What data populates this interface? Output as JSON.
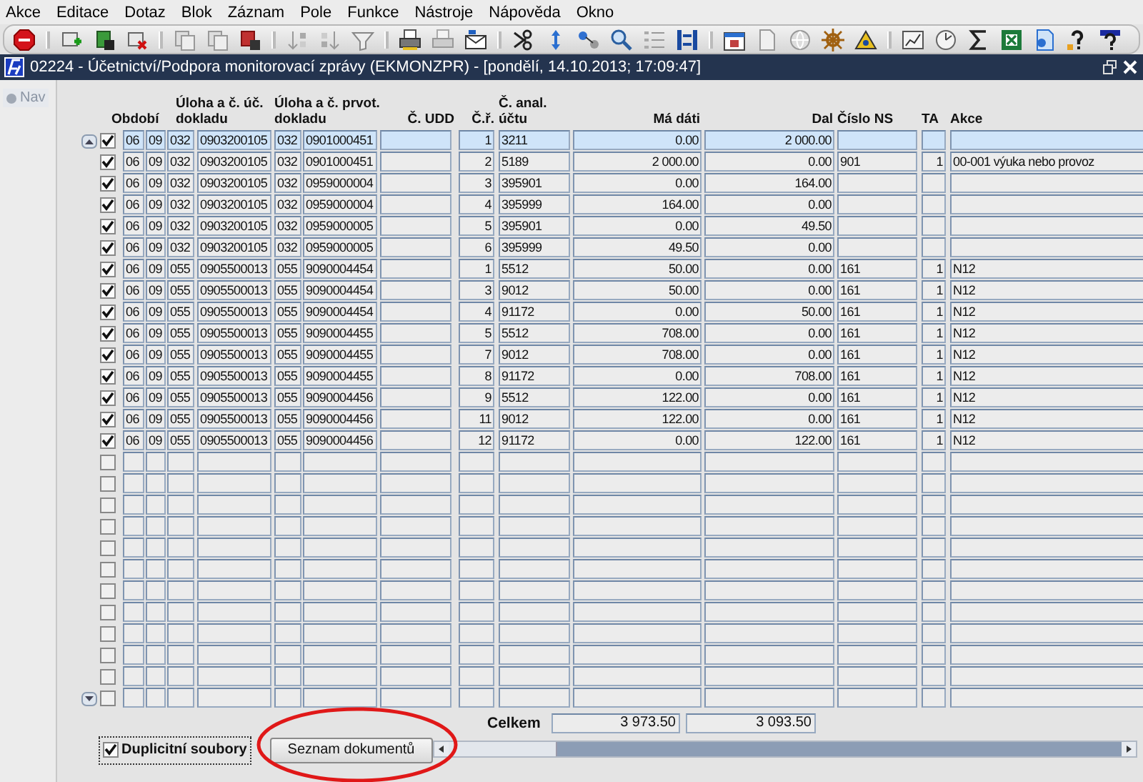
{
  "menu": [
    "Akce",
    "Editace",
    "Dotaz",
    "Blok",
    "Záznam",
    "Pole",
    "Funkce",
    "Nástroje",
    "Nápověda",
    "Okno"
  ],
  "window": {
    "title": "02224 - Účetnictví/Podpora monitorovací zprávy (EKMONZPR) - [pondělí, 14.10.2013; 17:09:47]"
  },
  "nav": {
    "label": "Nav"
  },
  "table": {
    "headers": [
      "Období",
      "Úloha a č. úč. dokladu",
      "Úloha a č. prvot. dokladu",
      "Č. UDD",
      "Č.ř.",
      "Č. anal. účtu",
      "Má dáti",
      "Dal",
      "Číslo NS",
      "TA",
      "Akce"
    ],
    "rows": [
      {
        "checked": true,
        "selected": true,
        "cells": [
          "06",
          "09",
          "032",
          "0903200105",
          "032",
          "0901000451",
          "",
          "1",
          "3211",
          "0.00",
          "2 000.00",
          "",
          "",
          ""
        ]
      },
      {
        "checked": true,
        "selected": false,
        "cells": [
          "06",
          "09",
          "032",
          "0903200105",
          "032",
          "0901000451",
          "",
          "2",
          "5189",
          "2 000.00",
          "0.00",
          "901",
          "1",
          "00-001 výuka nebo provoz"
        ]
      },
      {
        "checked": true,
        "selected": false,
        "cells": [
          "06",
          "09",
          "032",
          "0903200105",
          "032",
          "0959000004",
          "",
          "3",
          "395901",
          "0.00",
          "164.00",
          "",
          "",
          ""
        ]
      },
      {
        "checked": true,
        "selected": false,
        "cells": [
          "06",
          "09",
          "032",
          "0903200105",
          "032",
          "0959000004",
          "",
          "4",
          "395999",
          "164.00",
          "0.00",
          "",
          "",
          ""
        ]
      },
      {
        "checked": true,
        "selected": false,
        "cells": [
          "06",
          "09",
          "032",
          "0903200105",
          "032",
          "0959000005",
          "",
          "5",
          "395901",
          "0.00",
          "49.50",
          "",
          "",
          ""
        ]
      },
      {
        "checked": true,
        "selected": false,
        "cells": [
          "06",
          "09",
          "032",
          "0903200105",
          "032",
          "0959000005",
          "",
          "6",
          "395999",
          "49.50",
          "0.00",
          "",
          "",
          ""
        ]
      },
      {
        "checked": true,
        "selected": false,
        "cells": [
          "06",
          "09",
          "055",
          "0905500013",
          "055",
          "9090004454",
          "",
          "1",
          "5512",
          "50.00",
          "0.00",
          "161",
          "1",
          "N12"
        ]
      },
      {
        "checked": true,
        "selected": false,
        "cells": [
          "06",
          "09",
          "055",
          "0905500013",
          "055",
          "9090004454",
          "",
          "3",
          "9012",
          "50.00",
          "0.00",
          "161",
          "1",
          "N12"
        ]
      },
      {
        "checked": true,
        "selected": false,
        "cells": [
          "06",
          "09",
          "055",
          "0905500013",
          "055",
          "9090004454",
          "",
          "4",
          "91172",
          "0.00",
          "50.00",
          "161",
          "1",
          "N12"
        ]
      },
      {
        "checked": true,
        "selected": false,
        "cells": [
          "06",
          "09",
          "055",
          "0905500013",
          "055",
          "9090004455",
          "",
          "5",
          "5512",
          "708.00",
          "0.00",
          "161",
          "1",
          "N12"
        ]
      },
      {
        "checked": true,
        "selected": false,
        "cells": [
          "06",
          "09",
          "055",
          "0905500013",
          "055",
          "9090004455",
          "",
          "7",
          "9012",
          "708.00",
          "0.00",
          "161",
          "1",
          "N12"
        ]
      },
      {
        "checked": true,
        "selected": false,
        "cells": [
          "06",
          "09",
          "055",
          "0905500013",
          "055",
          "9090004455",
          "",
          "8",
          "91172",
          "0.00",
          "708.00",
          "161",
          "1",
          "N12"
        ]
      },
      {
        "checked": true,
        "selected": false,
        "cells": [
          "06",
          "09",
          "055",
          "0905500013",
          "055",
          "9090004456",
          "",
          "9",
          "5512",
          "122.00",
          "0.00",
          "161",
          "1",
          "N12"
        ]
      },
      {
        "checked": true,
        "selected": false,
        "cells": [
          "06",
          "09",
          "055",
          "0905500013",
          "055",
          "9090004456",
          "",
          "11",
          "9012",
          "122.00",
          "0.00",
          "161",
          "1",
          "N12"
        ]
      },
      {
        "checked": true,
        "selected": false,
        "cells": [
          "06",
          "09",
          "055",
          "0905500013",
          "055",
          "9090004456",
          "",
          "12",
          "91172",
          "0.00",
          "122.00",
          "161",
          "1",
          "N12"
        ]
      },
      {
        "checked": false,
        "selected": false,
        "cells": [
          "",
          "",
          "",
          "",
          "",
          "",
          "",
          "",
          "",
          "",
          "",
          "",
          "",
          ""
        ]
      },
      {
        "checked": false,
        "selected": false,
        "cells": [
          "",
          "",
          "",
          "",
          "",
          "",
          "",
          "",
          "",
          "",
          "",
          "",
          "",
          ""
        ]
      },
      {
        "checked": false,
        "selected": false,
        "cells": [
          "",
          "",
          "",
          "",
          "",
          "",
          "",
          "",
          "",
          "",
          "",
          "",
          "",
          ""
        ]
      },
      {
        "checked": false,
        "selected": false,
        "cells": [
          "",
          "",
          "",
          "",
          "",
          "",
          "",
          "",
          "",
          "",
          "",
          "",
          "",
          ""
        ]
      },
      {
        "checked": false,
        "selected": false,
        "cells": [
          "",
          "",
          "",
          "",
          "",
          "",
          "",
          "",
          "",
          "",
          "",
          "",
          "",
          ""
        ]
      },
      {
        "checked": false,
        "selected": false,
        "cells": [
          "",
          "",
          "",
          "",
          "",
          "",
          "",
          "",
          "",
          "",
          "",
          "",
          "",
          ""
        ]
      },
      {
        "checked": false,
        "selected": false,
        "cells": [
          "",
          "",
          "",
          "",
          "",
          "",
          "",
          "",
          "",
          "",
          "",
          "",
          "",
          ""
        ]
      },
      {
        "checked": false,
        "selected": false,
        "cells": [
          "",
          "",
          "",
          "",
          "",
          "",
          "",
          "",
          "",
          "",
          "",
          "",
          "",
          ""
        ]
      },
      {
        "checked": false,
        "selected": false,
        "cells": [
          "",
          "",
          "",
          "",
          "",
          "",
          "",
          "",
          "",
          "",
          "",
          "",
          "",
          ""
        ]
      },
      {
        "checked": false,
        "selected": false,
        "cells": [
          "",
          "",
          "",
          "",
          "",
          "",
          "",
          "",
          "",
          "",
          "",
          "",
          "",
          ""
        ]
      },
      {
        "checked": false,
        "selected": false,
        "cells": [
          "",
          "",
          "",
          "",
          "",
          "",
          "",
          "",
          "",
          "",
          "",
          "",
          "",
          ""
        ]
      },
      {
        "checked": false,
        "selected": false,
        "cells": [
          "",
          "",
          "",
          "",
          "",
          "",
          "",
          "",
          "",
          "",
          "",
          "",
          "",
          ""
        ]
      }
    ]
  },
  "footer": {
    "duplicates": {
      "label": "Duplicitní soubory",
      "checked": true
    },
    "documents_button": "Seznam dokumentů",
    "total_label": "Celkem",
    "totals": [
      "3 973.50",
      "3 093.50"
    ]
  }
}
